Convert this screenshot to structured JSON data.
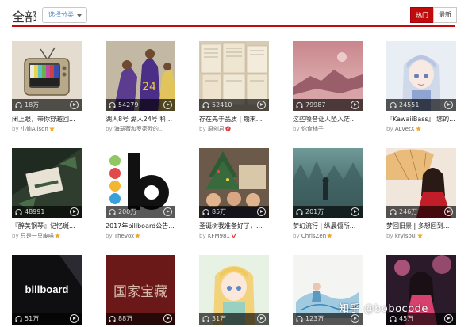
{
  "header": {
    "title": "全部",
    "select_label": "选择分类",
    "tab_hot": "热门",
    "tab_new": "最新"
  },
  "colors": {
    "accent": "#c20c0c",
    "link": "#4a8ac8"
  },
  "cards": [
    {
      "count": "18万",
      "name": "闭上眼，带你穿越回...",
      "by": "by",
      "author": "小仙Alison",
      "badge": "star"
    },
    {
      "count": "54279",
      "name": "湖人8号 湖人24号 科...",
      "by": "by",
      "author": "海瑟薇和罗密欧的...",
      "badge": ""
    },
    {
      "count": "52410",
      "name": "存在先于品质 | 期末...",
      "by": "by",
      "author": "原创君",
      "badge": "daren"
    },
    {
      "count": "79987",
      "name": "这些嗓音让人坠入茫...",
      "by": "by",
      "author": "你食柿子",
      "badge": ""
    },
    {
      "count": "24551",
      "name": "『KawaiiBass』 您的...",
      "by": "by",
      "author": "ALvetX",
      "badge": "star"
    },
    {
      "count": "48991",
      "name": "『醉美钢琴』记忆斑...",
      "by": "by",
      "author": "只是一只废喵",
      "badge": "star"
    },
    {
      "count": "200万",
      "name": "2017年billboard公告...",
      "by": "by",
      "author": "Thevox",
      "badge": "star"
    },
    {
      "count": "85万",
      "name": "圣诞树我准备好了，...",
      "by": "by",
      "author": "KFM981",
      "badge": "v"
    },
    {
      "count": "201万",
      "name": "梦幻流行 | 纵晨傷所...",
      "by": "by",
      "author": "ChrisZen",
      "badge": "star"
    },
    {
      "count": "246万",
      "name": "梦回旧景 | 多想回到...",
      "by": "by",
      "author": "krylsoul",
      "badge": "star"
    },
    {
      "count": "51万",
      "name": "",
      "by": "",
      "author": "",
      "badge": "",
      "cover_text": "billboard"
    },
    {
      "count": "88万",
      "name": "",
      "by": "",
      "author": "",
      "badge": "",
      "cover_text": "国家宝藏"
    },
    {
      "count": "31万",
      "name": "",
      "by": "",
      "author": "",
      "badge": ""
    },
    {
      "count": "123万",
      "name": "",
      "by": "",
      "author": "",
      "badge": ""
    },
    {
      "count": "45万",
      "name": "",
      "by": "",
      "author": "",
      "badge": ""
    }
  ],
  "watermark": {
    "text": "知乎 @bobocode"
  }
}
